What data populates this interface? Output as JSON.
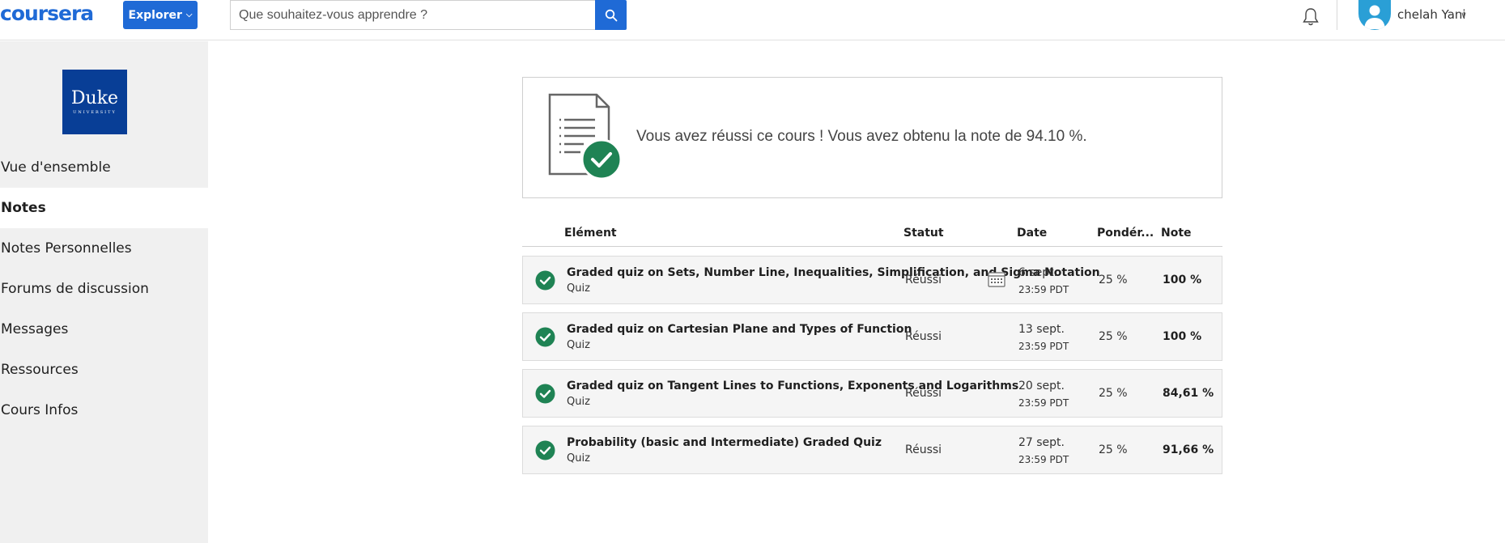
{
  "header": {
    "logo": "coursera",
    "explore_label": "Explorer",
    "search_placeholder": "Que souhaitez-vous apprendre ?",
    "user_name": "chelah Yani",
    "accent_color": "#1f6ad6"
  },
  "sidebar": {
    "institution_logo": {
      "line1": "Duke",
      "line2": "UNIVERSITY",
      "color": "#083e96"
    },
    "items": [
      {
        "label": "Vue d'ensemble"
      },
      {
        "label": "Notes"
      },
      {
        "label": "Notes Personnelles"
      },
      {
        "label": "Forums de discussion"
      },
      {
        "label": "Messages"
      },
      {
        "label": "Ressources"
      },
      {
        "label": "Cours Infos"
      }
    ]
  },
  "banner": {
    "message": "Vous avez réussi ce cours ! Vous avez obtenu la note de 94.10 %.",
    "success_color": "#1f8354"
  },
  "table": {
    "headers": {
      "item": "Elément",
      "status": "Statut",
      "date": "Date",
      "weight": "Pondér...",
      "grade": "Note"
    },
    "rows": [
      {
        "title": "Graded quiz on Sets, Number Line, Inequalities, Simplification, and Sigma Notation",
        "type": "Quiz",
        "status": "Réussi",
        "date": "6 sept.",
        "time": "23:59 PDT",
        "weight": "25 %",
        "grade": "100 %"
      },
      {
        "title": "Graded quiz on Cartesian Plane and Types of Function",
        "type": "Quiz",
        "status": "Réussi",
        "date": "13 sept.",
        "time": "23:59 PDT",
        "weight": "25 %",
        "grade": "100 %"
      },
      {
        "title": "Graded quiz on Tangent Lines to Functions, Exponents and Logarithms",
        "type": "Quiz",
        "status": "Réussi",
        "date": "20 sept.",
        "time": "23:59 PDT",
        "weight": "25 %",
        "grade": "84,61 %"
      },
      {
        "title": "Probability (basic and Intermediate) Graded Quiz",
        "type": "Quiz",
        "status": "Réussi",
        "date": "27 sept.",
        "time": "23:59 PDT",
        "weight": "25 %",
        "grade": "91,66 %"
      }
    ]
  }
}
